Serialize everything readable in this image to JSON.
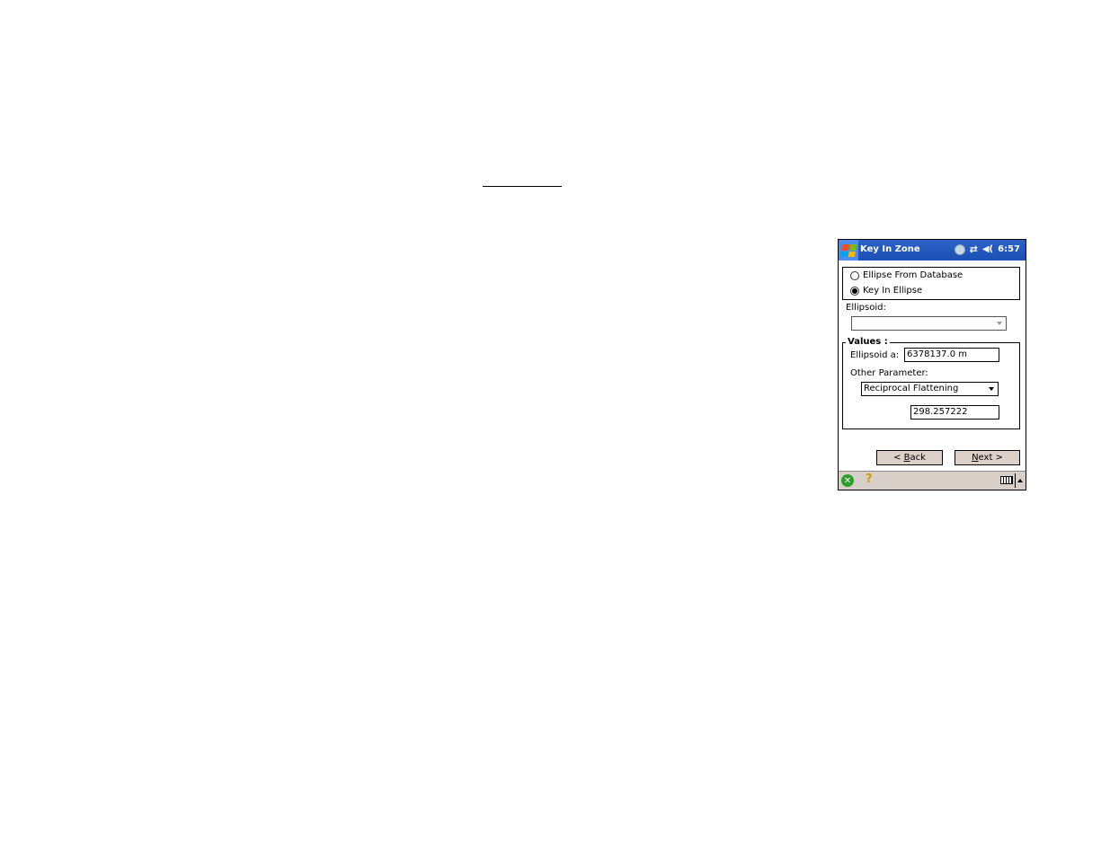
{
  "titlebar": {
    "title": "Key In Zone",
    "time": "6:57",
    "icons": [
      "windows-start-icon",
      "connectivity-globe-icon",
      "sync-arrows-icon",
      "speaker-icon"
    ]
  },
  "source_group": {
    "options": [
      {
        "label": "Ellipse From Database",
        "selected": false
      },
      {
        "label": "Key In Ellipse",
        "selected": true
      }
    ]
  },
  "ellipsoid": {
    "label": "Ellipsoid:",
    "value": ""
  },
  "values_group": {
    "title": "Values :",
    "ellipsoid_a_label": "Ellipsoid a:",
    "ellipsoid_a_value": "6378137.0 m",
    "other_param_label": "Other Parameter:",
    "other_param_selected": "Reciprocal Flattening",
    "other_param_value": "298.257222"
  },
  "buttons": {
    "back_prefix": "< ",
    "back_mnemonic": "B",
    "back_rest": "ack",
    "next_mnemonic": "N",
    "next_rest": "ext >"
  },
  "bottombar": {
    "ok_glyph": "✕",
    "help_glyph": "?"
  }
}
